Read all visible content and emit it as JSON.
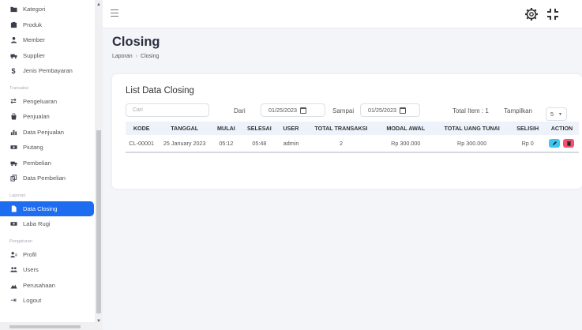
{
  "sidebar": {
    "items_top": [
      {
        "label": "Kategori",
        "icon": "folder-icon"
      },
      {
        "label": "Produk",
        "icon": "box-icon"
      },
      {
        "label": "Member",
        "icon": "user-icon"
      },
      {
        "label": "Supplier",
        "icon": "truck-icon"
      },
      {
        "label": "Jenis Pembayaran",
        "icon": "dollar-icon"
      }
    ],
    "section_transaksi": "Transaksi",
    "items_transaksi": [
      {
        "label": "Pengeluaran",
        "icon": "exchange-icon"
      },
      {
        "label": "Penjualan",
        "icon": "bag-icon"
      },
      {
        "label": "Data Penjualan",
        "icon": "chart-icon"
      },
      {
        "label": "Piutang",
        "icon": "money-icon"
      },
      {
        "label": "Pembelian",
        "icon": "truck-icon"
      },
      {
        "label": "Data Pembelian",
        "icon": "copy-icon"
      }
    ],
    "section_laporan": "Laporan",
    "items_laporan": [
      {
        "label": "Data Closing",
        "icon": "file-icon"
      },
      {
        "label": "Laba Rugi",
        "icon": "money-icon"
      }
    ],
    "section_pengaturan": "Pengaturan",
    "items_pengaturan": [
      {
        "label": "Profil",
        "icon": "profile-icon"
      },
      {
        "label": "Users",
        "icon": "users-icon"
      },
      {
        "label": "Perusahaan",
        "icon": "company-icon"
      },
      {
        "label": "Logout",
        "icon": "logout-icon"
      }
    ],
    "active_color": "#1e6cf0"
  },
  "page": {
    "title": "Closing",
    "breadcrumb_root": "Laporan",
    "breadcrumb_sep": "›",
    "breadcrumb_current": "Closing"
  },
  "card": {
    "title": "List Data Closing",
    "search_placeholder": "Cari",
    "dari_label": "Dari",
    "dari_value": "01/25/2023",
    "sampai_label": "Sampai",
    "sampai_value": "01/25/2023",
    "total_item": "Total Item : 1",
    "tampilkan_label": "Tampilkan",
    "tampilkan_value": "5"
  },
  "table": {
    "headers": [
      "KODE",
      "TANGGAL",
      "MULAI",
      "SELESAI",
      "USER",
      "TOTAL TRANSAKSI",
      "MODAL AWAL",
      "TOTAL UANG TUNAI",
      "SELISIH",
      "ACTION"
    ],
    "rows": [
      [
        "CL-00001",
        "25 January 2023",
        "05:12",
        "05:48",
        "admin",
        "2",
        "Rp 300.000",
        "Rp 300.000",
        "Rp 0"
      ]
    ]
  },
  "colors": {
    "edit": "#3ec6ee",
    "delete": "#f2536b",
    "table_header": "#eef3fb"
  }
}
